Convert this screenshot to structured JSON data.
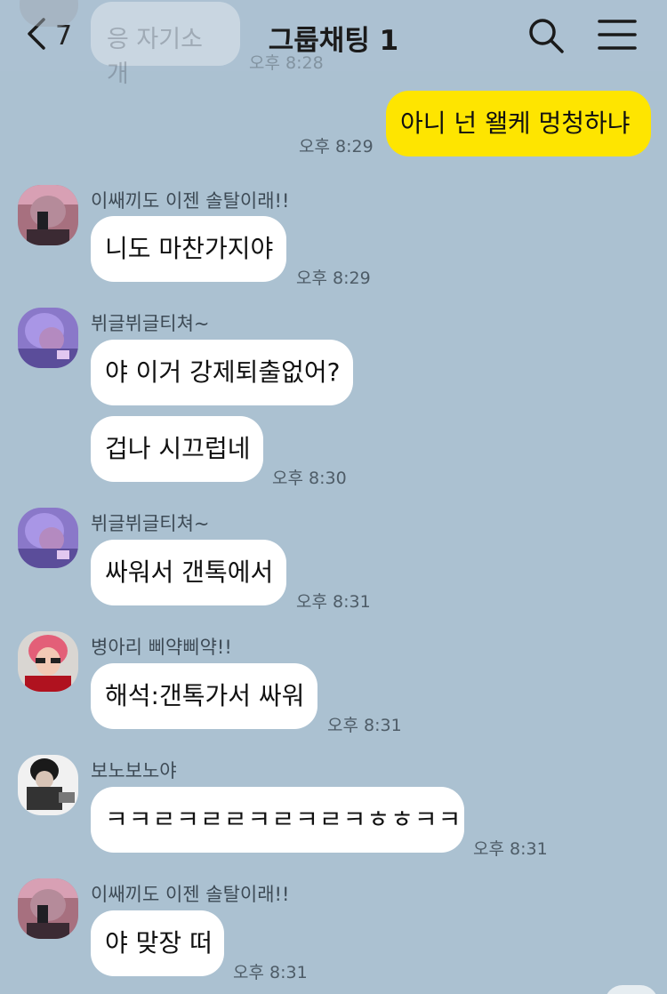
{
  "header": {
    "back_count": "7",
    "title": "그룹채팅 1"
  },
  "ghost_message": {
    "text": "응 자기소개",
    "time": "오후 8:28"
  },
  "messages": [
    {
      "text": "아니 넌 왤케 멍청하냐",
      "time": "오후 8:29",
      "mine": true
    },
    {
      "sender": "이쌔끼도 이젠 솔탈이래!!",
      "text": "니도 마찬가지야",
      "time": "오후 8:29"
    },
    {
      "sender": "뷔글뷔글티쳐~",
      "text": "야 이거 강제퇴출없어?"
    },
    {
      "text": "겁나 시끄럽네",
      "time": "오후 8:30"
    },
    {
      "sender": "뷔글뷔글티쳐~",
      "text": "싸워서 갠톡에서",
      "time": "오후 8:31"
    },
    {
      "sender": "병아리 삐약삐약!!",
      "text": "해석:갠톡가서 싸워",
      "time": "오후 8:31"
    },
    {
      "sender": "보노보노야",
      "text": "ㅋㅋㄹㅋㄹㄹㅋㄹㅋㄹㅋㅎㅎㅋㅋ",
      "time": "오후 8:31"
    },
    {
      "sender": "이쌔끼도 이젠 솔탈이래!!",
      "text": "야 맞장 떠",
      "time": "오후 8:31"
    }
  ],
  "icons": {
    "back": "chevron-left-icon",
    "search": "search-icon",
    "menu": "hamburger-menu-icon"
  },
  "colors": {
    "background": "#abc1d1",
    "my_bubble": "#fee500",
    "other_bubble": "#ffffff"
  }
}
